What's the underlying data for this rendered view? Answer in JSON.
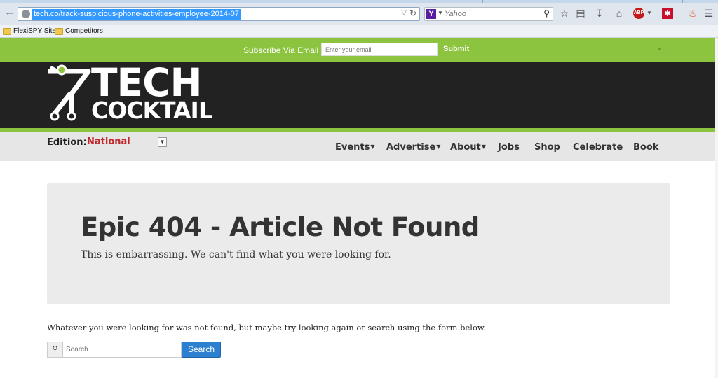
{
  "browser": {
    "url": "tech.co/track-suspicious-phone-activities-employee-2014-07",
    "search_placeholder": "Yahoo",
    "search_engine_letter": "Y",
    "abp_label": "ABP",
    "bookmarks": [
      "FlexiSPY Sites",
      "Competitors"
    ]
  },
  "subscribe": {
    "label": "Subscribe Via Email",
    "email_placeholder": "Enter your email",
    "submit_label": "Submit",
    "close_label": "×"
  },
  "logo": {
    "line1": "TECH",
    "line2": "COCKTAIL"
  },
  "nav": {
    "edition_label": "Edition:",
    "edition_value": "National",
    "items": [
      "Events",
      "Advertise",
      "About",
      "Jobs",
      "Shop",
      "Celebrate",
      "Book"
    ]
  },
  "content": {
    "title": "Epic 404 - Article Not Found",
    "subtitle": "This is embarrassing. We can't find what you were looking for.",
    "body": "Whatever you were looking for was not found, but maybe try looking again or search using the form below.",
    "search_placeholder": "Search",
    "search_button": "Search"
  },
  "colors": {
    "green": "#8cc43f",
    "dark": "#222222",
    "red": "#c0272d",
    "blue": "#2d7fcf"
  }
}
